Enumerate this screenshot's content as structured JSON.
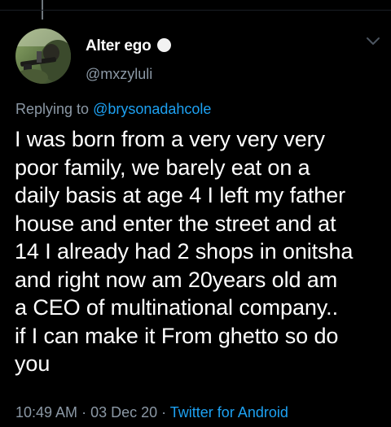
{
  "tweet": {
    "author": {
      "display_name": "Alter ego",
      "handle": "@mxzyluli"
    },
    "reply": {
      "prefix": "Replying to ",
      "mention": "@brysonadahcole"
    },
    "body_lines": [
      "I was born from a very very very",
      "poor family, we barely eat on a",
      "daily basis at age 4 I left my father",
      "house and enter the street and at",
      "14 I already had 2 shops in onitsha",
      "and right now am 20years old am",
      "a CEO  of multinational company..",
      "if I can make it From ghetto so do",
      "you"
    ],
    "meta": {
      "time": "10:49 AM",
      "separator_1": " · ",
      "date": "03 Dec 20",
      "separator_2": " · ",
      "source": "Twitter for Android"
    },
    "icons": {
      "status_badge": "white-circle-icon",
      "more": "chevron-down-icon"
    }
  },
  "colors": {
    "background": "#000000",
    "text_primary": "#ffffff",
    "text_secondary": "#8b98a5",
    "accent": "#1da1f2"
  }
}
